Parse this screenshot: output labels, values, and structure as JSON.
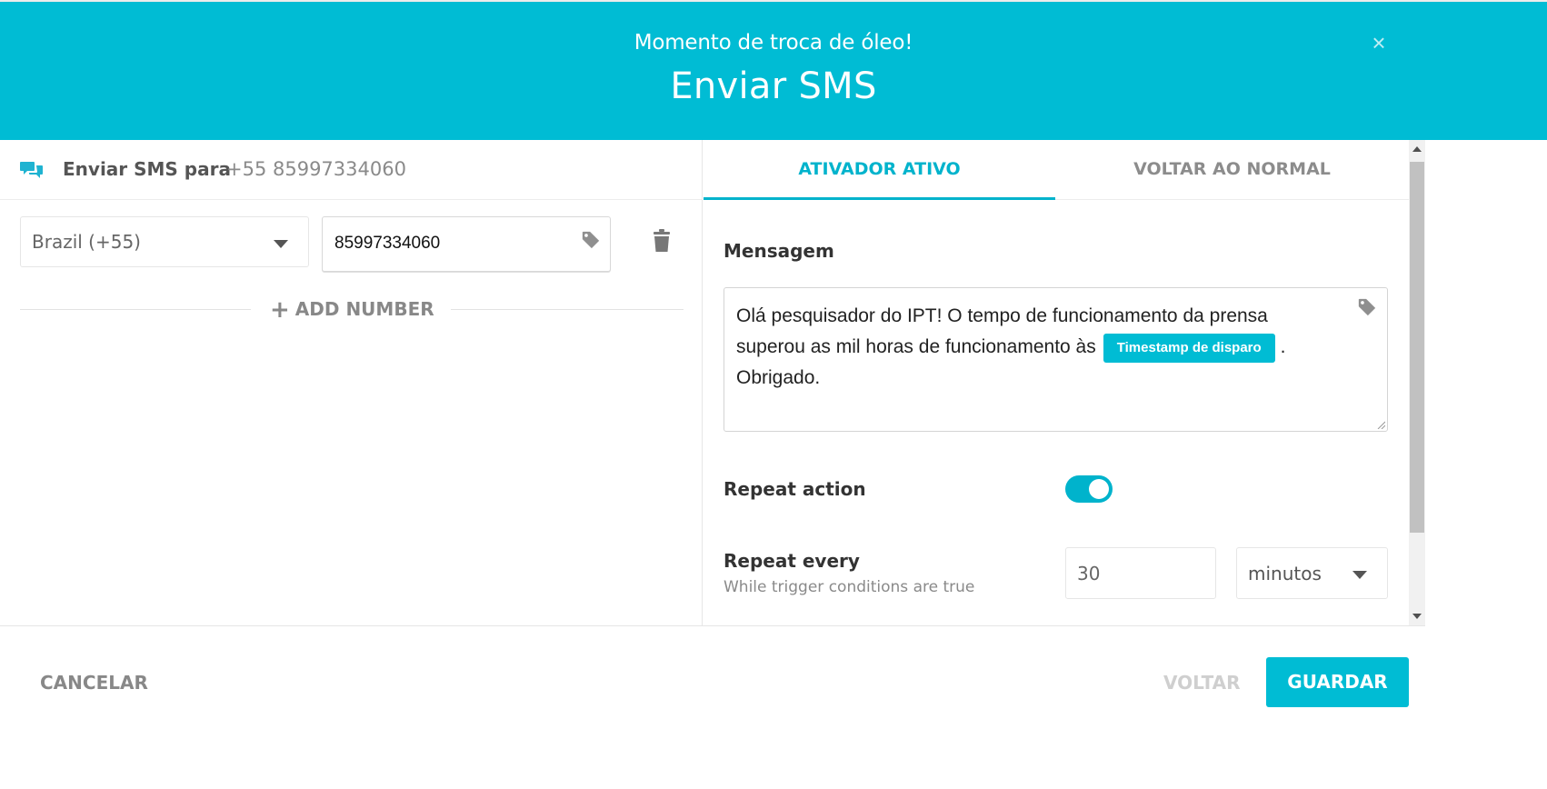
{
  "header": {
    "subtitle": "Momento de troca de óleo!",
    "title": "Enviar SMS",
    "close_label": "×"
  },
  "left_panel": {
    "send_to_label": "Enviar SMS para",
    "send_to_number": "+55 85997334060",
    "country_select": "Brazil (+55)",
    "phone_value": "85997334060",
    "add_number_label": "ADD NUMBER"
  },
  "tabs": [
    {
      "label": "ATIVADOR ATIVO",
      "active": true
    },
    {
      "label": "VOLTAR AO NORMAL",
      "active": false
    }
  ],
  "message": {
    "label": "Mensagem",
    "text_before": "Olá pesquisador do IPT! O tempo de funcionamento da prensa superou as mil horas de funcionamento às",
    "chip": "Timestamp de disparo",
    "text_after": ". Obrigado."
  },
  "repeat": {
    "action_label": "Repeat action",
    "enabled": true,
    "every_label": "Repeat every",
    "every_hint": "While trigger conditions are true",
    "interval_value": "30",
    "unit": "minutos"
  },
  "footer": {
    "cancel_label": "CANCELAR",
    "back_label": "VOLTAR",
    "save_label": "GUARDAR"
  },
  "colors": {
    "accent": "#00bcd4",
    "accent_dark": "#00b3cc"
  },
  "icons": [
    "chat-icon",
    "tag-icon",
    "trash-icon",
    "close-icon",
    "chevron-down-icon",
    "plus-icon"
  ]
}
